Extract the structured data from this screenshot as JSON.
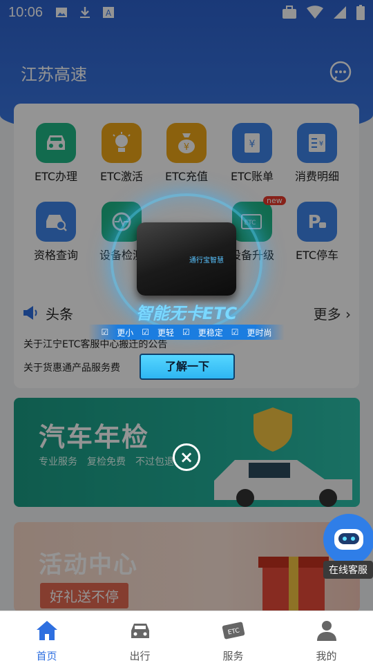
{
  "status_bar": {
    "time": "10:06"
  },
  "header": {
    "title": "江苏高速"
  },
  "services": [
    {
      "label": "ETC办理",
      "icon": "car-icon",
      "color": "#1fb887"
    },
    {
      "label": "ETC激活",
      "icon": "bulb-icon",
      "color": "#f0a818"
    },
    {
      "label": "ETC充值",
      "icon": "money-bag-icon",
      "color": "#f0a818"
    },
    {
      "label": "ETC账单",
      "icon": "bill-icon",
      "color": "#3e86ea"
    },
    {
      "label": "消费明细",
      "icon": "receipt-icon",
      "color": "#3e86ea"
    },
    {
      "label": "资格查询",
      "icon": "car-search-icon",
      "color": "#3e86ea"
    },
    {
      "label": "设备检测",
      "icon": "device-check-icon",
      "color": "#1fb887"
    },
    {
      "label": "设备升级",
      "icon": "etc-upgrade-icon",
      "color": "#1fb887",
      "badge": "new"
    },
    {
      "label": "ETC停车",
      "icon": "parking-icon",
      "color": "#3e86ea"
    }
  ],
  "news": {
    "title": "头条",
    "more": "更多",
    "items": [
      "关于江宁ETC客服中心搬迁的公告",
      "关于货惠通产品服务费"
    ]
  },
  "banner1": {
    "title": "汽车年检",
    "tags": [
      "专业服务",
      "复检免费",
      "不过包退"
    ]
  },
  "banner2": {
    "title": "活动中心",
    "pill": "好礼送不停"
  },
  "customer_service": {
    "label": "在线客服"
  },
  "popup": {
    "device_brand": "通行宝智慧",
    "title": "智能无卡ETC",
    "features": [
      "更小",
      "更轻",
      "更稳定",
      "更时尚"
    ],
    "button": "了解一下"
  },
  "tabs": [
    {
      "label": "首页",
      "icon": "home-icon",
      "active": true
    },
    {
      "label": "出行",
      "icon": "car-icon",
      "active": false
    },
    {
      "label": "服务",
      "icon": "etc-ticket-icon",
      "active": false
    },
    {
      "label": "我的",
      "icon": "user-icon",
      "active": false
    }
  ],
  "colors": {
    "primary": "#2e6fe0",
    "header": "#3a78e3"
  }
}
